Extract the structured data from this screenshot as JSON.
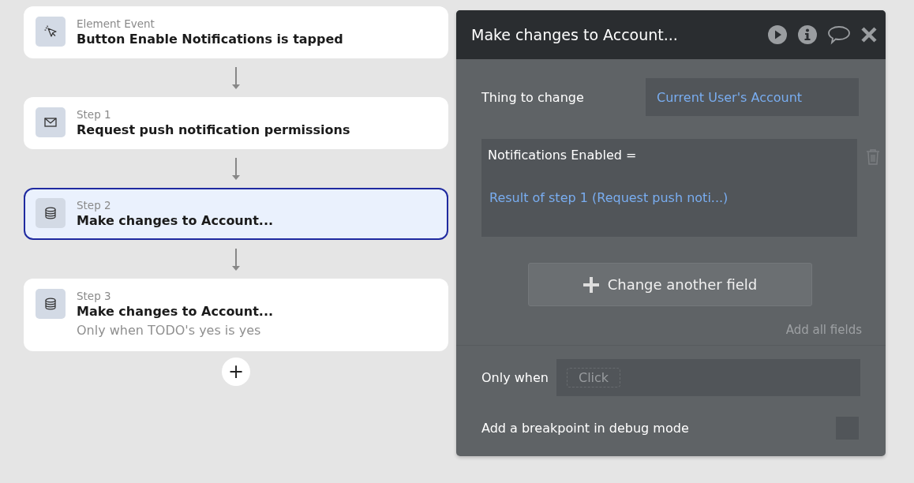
{
  "workflow": {
    "steps": [
      {
        "kind": "cursor",
        "label": "Element Event",
        "title": "Button Enable Notifications is tapped",
        "selected": false
      },
      {
        "kind": "mail",
        "label": "Step 1",
        "title": "Request push notification permissions",
        "selected": false
      },
      {
        "kind": "database",
        "label": "Step 2",
        "title": "Make changes to Account...",
        "selected": true
      },
      {
        "kind": "database",
        "label": "Step 3",
        "title": "Make changes to Account...",
        "condition": "Only when TODO's yes is yes",
        "selected": false
      }
    ],
    "add_button": "+"
  },
  "panel": {
    "title": "Make changes to Account...",
    "thing_to_change": {
      "label": "Thing to change",
      "value": "Current User's Account"
    },
    "fields": [
      {
        "name": "Notifications Enabled =",
        "value": "Result of step 1 (Request push noti...)"
      }
    ],
    "change_another_button": "Change another field",
    "add_all_fields": "Add all fields",
    "only_when": {
      "label": "Only when",
      "prompt": "Click"
    },
    "breakpoint": {
      "label": "Add a breakpoint in debug mode",
      "checked": false
    }
  }
}
